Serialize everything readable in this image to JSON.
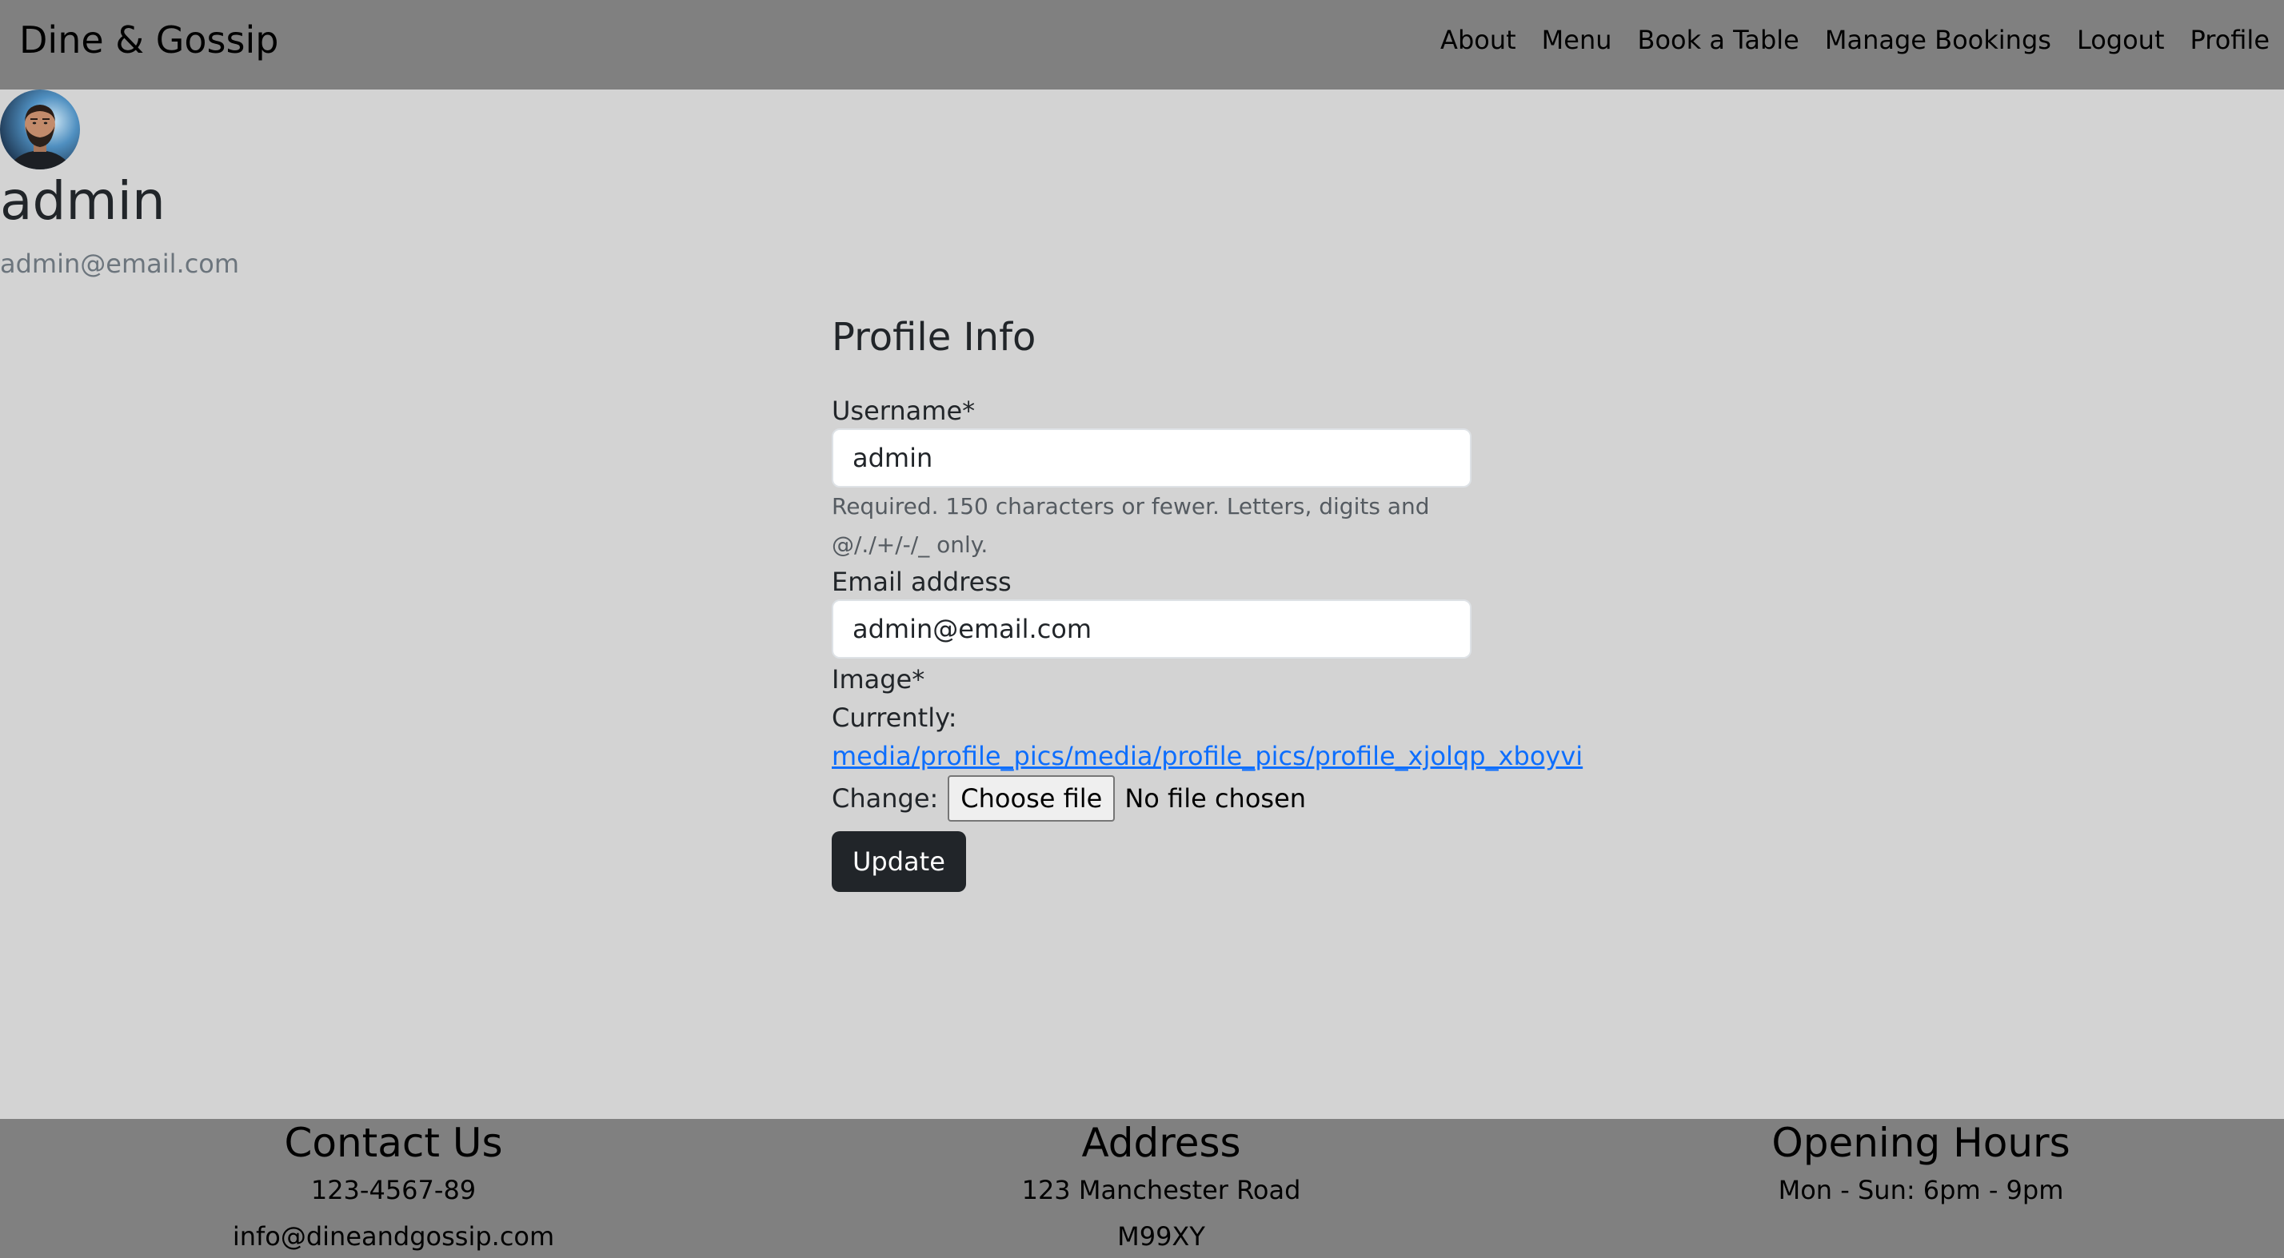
{
  "navbar": {
    "brand": "Dine & Gossip",
    "links": [
      "About",
      "Menu",
      "Book a Table",
      "Manage Bookings",
      "Logout",
      "Profile"
    ]
  },
  "profile": {
    "username": "admin",
    "email": "admin@email.com"
  },
  "form": {
    "title": "Profile Info",
    "username_label": "Username*",
    "username_value": "admin",
    "username_help": "Required. 150 characters or fewer. Letters, digits and @/./+/-/_ only.",
    "email_label": "Email address",
    "email_value": "admin@email.com",
    "image_label": "Image*",
    "currently_label": "Currently:",
    "current_file": "media/profile_pics/media/profile_pics/profile_xjolqp_xboyvi",
    "change_label": "Change:",
    "choose_file_label": "Choose file",
    "no_file_text": "No file chosen",
    "submit_label": "Update"
  },
  "footer": {
    "contact": {
      "title": "Contact Us",
      "phone": "123-4567-89",
      "email": "info@dineandgossip.com"
    },
    "address": {
      "title": "Address",
      "line1": "123 Manchester Road",
      "line2": "M99XY"
    },
    "hours": {
      "title": "Opening Hours",
      "line1": "Mon - Sun: 6pm - 9pm"
    }
  }
}
